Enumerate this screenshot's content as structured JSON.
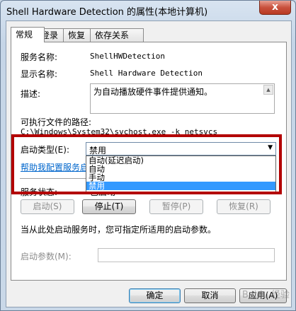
{
  "window": {
    "title": "Shell Hardware Detection 的属性(本地计算机)",
    "close_glyph": "x"
  },
  "tabs": [
    {
      "label": "常规",
      "active": true
    },
    {
      "label": "登录",
      "active": false
    },
    {
      "label": "恢复",
      "active": false
    },
    {
      "label": "依存关系",
      "active": false
    }
  ],
  "general": {
    "service_name_label": "服务名称:",
    "service_name_value": "ShellHWDetection",
    "display_name_label": "显示名称:",
    "display_name_value": "Shell Hardware Detection",
    "description_label": "描述:",
    "description_value": "为自动播放硬件事件提供通知。",
    "exe_path_label": "可执行文件的路径:",
    "exe_path_value": "C:\\Windows\\System32\\svchost.exe -k netsvcs",
    "startup_type_label": "启动类型(E):",
    "startup_type_value": "禁用",
    "startup_options": [
      "自动(延迟启动)",
      "自动",
      "手动",
      "禁用"
    ],
    "startup_selected_index": 3,
    "help_link": "帮助我配置服务启",
    "service_status_label": "服务状态:",
    "service_status_value": "已启动",
    "buttons": {
      "start": "启动(S)",
      "stop": "停止(T)",
      "pause": "暂停(P)",
      "resume": "恢复(R)"
    },
    "hint_text": "当从此处启动服务时，您可指定所适用的启动参数。",
    "start_params_label": "启动参数(M):",
    "start_params_value": ""
  },
  "footer": {
    "ok": "确定",
    "cancel": "取消",
    "apply": "应用(A)"
  },
  "watermark": "Baidu 经验"
}
